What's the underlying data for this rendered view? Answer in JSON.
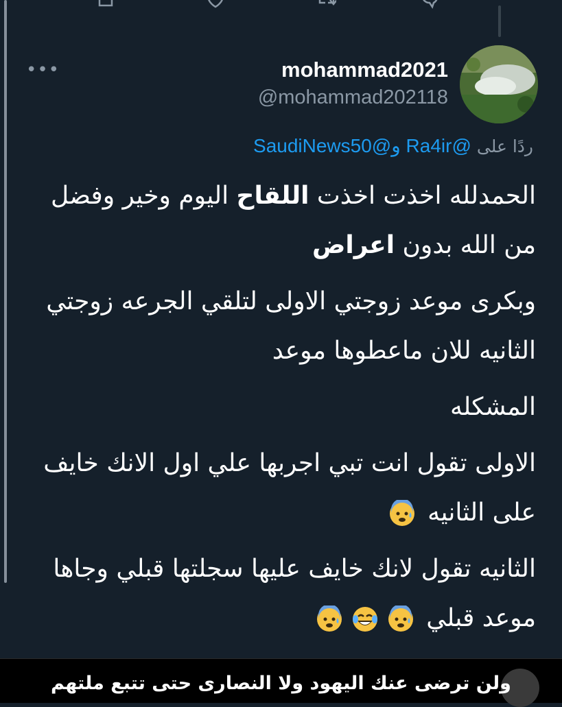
{
  "icons": {
    "top_actions": [
      "share-icon",
      "like-icon",
      "retweet-icon",
      "reply-icon"
    ],
    "more": "more-options-icon",
    "emoji_fearful": "anxious-face-with-sweat-emoji",
    "emoji_laugh": "face-with-tears-of-joy-emoji"
  },
  "tweet": {
    "display_name": "mohammad2021",
    "handle": "@mohammad202118",
    "reply_prefix": "ردًا على",
    "mention_1": "@Ra4ir",
    "mention_joiner": " و",
    "mention_2": "@SaudiNews50",
    "p1_a": "الحمدلله اخذت اخذت ",
    "p1_b": "اللقاح",
    "p1_c": " اليوم  وخير وفضل من الله بدون ",
    "p1_d": "اعراض",
    "p2": "وبكرى موعد زوجتي الاولى  لتلقي الجرعه زوجتي الثانيه للان ماعطوها موعد",
    "p3": "المشكله",
    "p4": "الاولى تقول انت تبي اجربها علي  اول الانك خايف على الثانيه",
    "p5_a": "الثانيه تقول لانك خايف عليها سجلتها قبلي",
    "p5_b": "وجاها موعد قبلي"
  },
  "bottom_bar": {
    "text": "ولن ترضى عنك اليهود ولا النصارى حتى تتبع ملتهم"
  },
  "colors": {
    "background": "#15202b",
    "muted": "#8b98a5",
    "link": "#1d9bf0"
  }
}
